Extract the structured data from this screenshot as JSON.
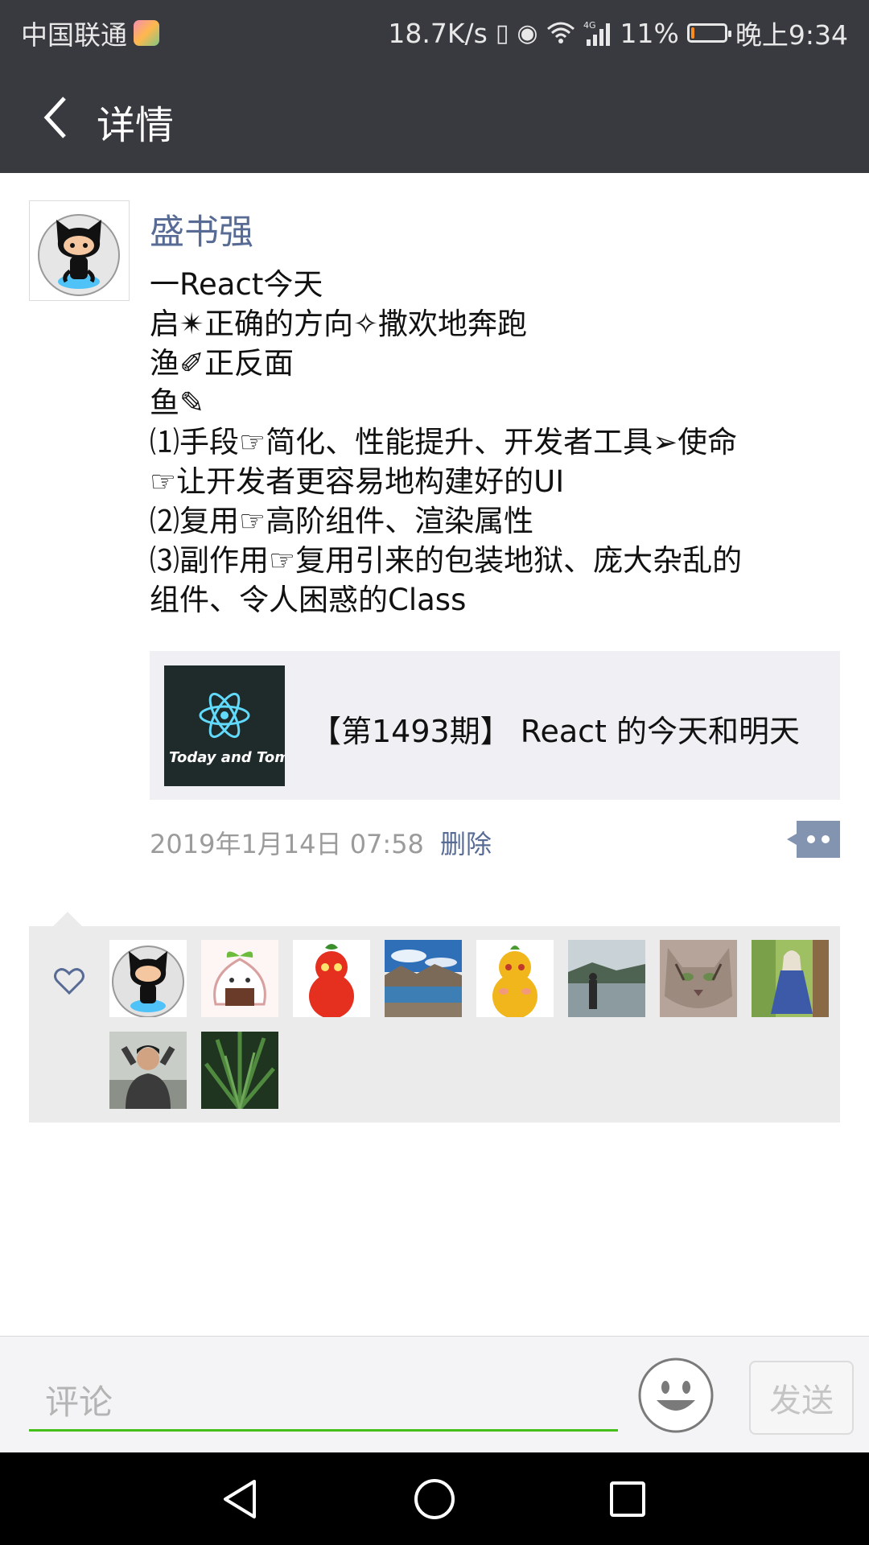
{
  "status_bar": {
    "carrier": "中国联通",
    "network_speed": "18.7K/s",
    "network_type": "4G",
    "battery_percent": "11%",
    "battery_level": 0.11,
    "time": "晚上9:34"
  },
  "header": {
    "title": "详情",
    "back_icon": "chevron-left-icon"
  },
  "post": {
    "author": "盛书强",
    "text_lines": [
      "一React今天",
      "启✴正确的方向✧撒欢地奔跑",
      "渔✐正反面",
      "鱼✎",
      "⑴手段☞简化、性能提升、开发者工具➢使命",
      "☞让开发者更容易地构建好的UI",
      "⑵复用☞高阶组件、渲染属性",
      "⑶副作用☞复用引来的包装地狱、庞大杂乱的",
      "组件、令人困惑的Class"
    ],
    "link": {
      "thumb_text": "Today and Tomorrow",
      "title": "【第1493期】 React 的今天和明天"
    },
    "timestamp": "2019年1月14日 07:58",
    "delete_label": "删除"
  },
  "likes": {
    "icon": "heart-icon",
    "avatars": [
      "octocat",
      "rice-ball",
      "red-gourd",
      "landscape",
      "yellow-gourd",
      "lake-photo",
      "cat-photo",
      "girl-photo",
      "man-photo",
      "plant-photo"
    ]
  },
  "comment_bar": {
    "placeholder": "评论",
    "emoji_icon": "smiley-icon",
    "send_label": "发送"
  },
  "colors": {
    "bar_dark": "#393a3f",
    "link_blue": "#576b95",
    "accent_green": "#45c01a"
  }
}
